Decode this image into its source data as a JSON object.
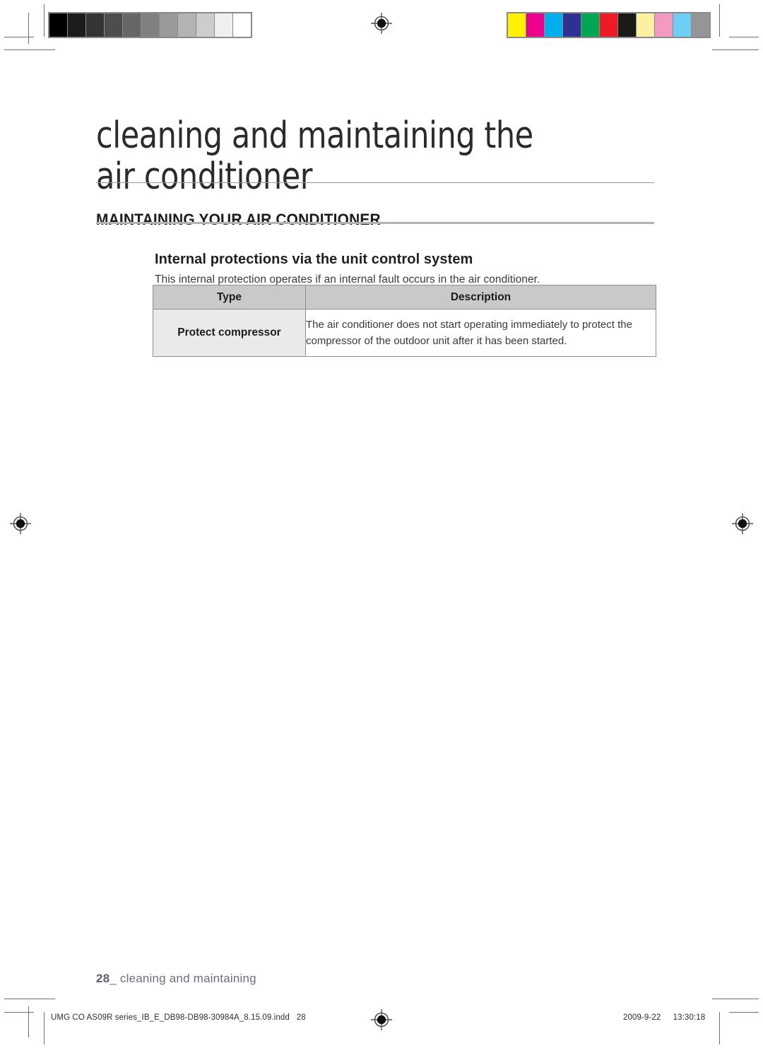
{
  "document": {
    "chapter_title_line1": "cleaning and maintaining the",
    "chapter_title_line2": "air conditioner",
    "section_heading": "MAINTAINING YOUR AIR CONDITIONER",
    "sub_heading": "Internal protections via the unit control system",
    "intro_text": "This internal protection operates if an internal fault occurs in the air conditioner."
  },
  "table": {
    "headers": [
      "Type",
      "Description"
    ],
    "rows": [
      {
        "type": "Protect compressor",
        "description": "The air conditioner does not start operating immediately to protect the compressor of the outdoor unit after it has been started."
      }
    ]
  },
  "footer": {
    "page_number": "28",
    "separator": "_",
    "section_label": "cleaning and maintaining"
  },
  "imprint": {
    "filename": "UMG CO AS09R series_IB_E_DB98-DB98-30984A_8.15.09.indd",
    "page": "28",
    "date": "2009-9-22",
    "time": "13:30:18"
  },
  "prepress": {
    "grayscale_wedge": [
      "#000000",
      "#1c1c1c",
      "#333333",
      "#4d4d4d",
      "#666666",
      "#808080",
      "#999999",
      "#b3b3b3",
      "#cccccc",
      "#efefef",
      "#ffffff"
    ],
    "color_patches": [
      "#fff200",
      "#ec008c",
      "#00adef",
      "#2e3192",
      "#00a651",
      "#ed1c24",
      "#1a1a1a",
      "#fbf1a0",
      "#f49ac1",
      "#6dcff6",
      "#939598"
    ],
    "registration_mark_name": "registration-target"
  }
}
